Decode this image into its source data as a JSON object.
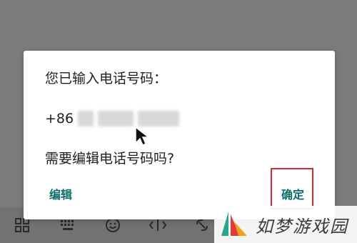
{
  "dialog": {
    "message_line1": "您已输入电话号码：",
    "phone_prefix": "+86",
    "message_line2": "需要编辑电话号码吗?",
    "edit_button": "编辑",
    "confirm_button": "确定"
  },
  "keyboard_toolbar": {
    "icons": [
      "grid-icon",
      "keyboard-icon",
      "emoji-icon",
      "text-cursor-icon",
      "link-icon"
    ]
  },
  "watermark": {
    "text": "如梦游戏园"
  },
  "colors": {
    "accent": "#0f6e6a",
    "highlight_box": "#e0262b",
    "scrim": "#7b7b7b"
  }
}
